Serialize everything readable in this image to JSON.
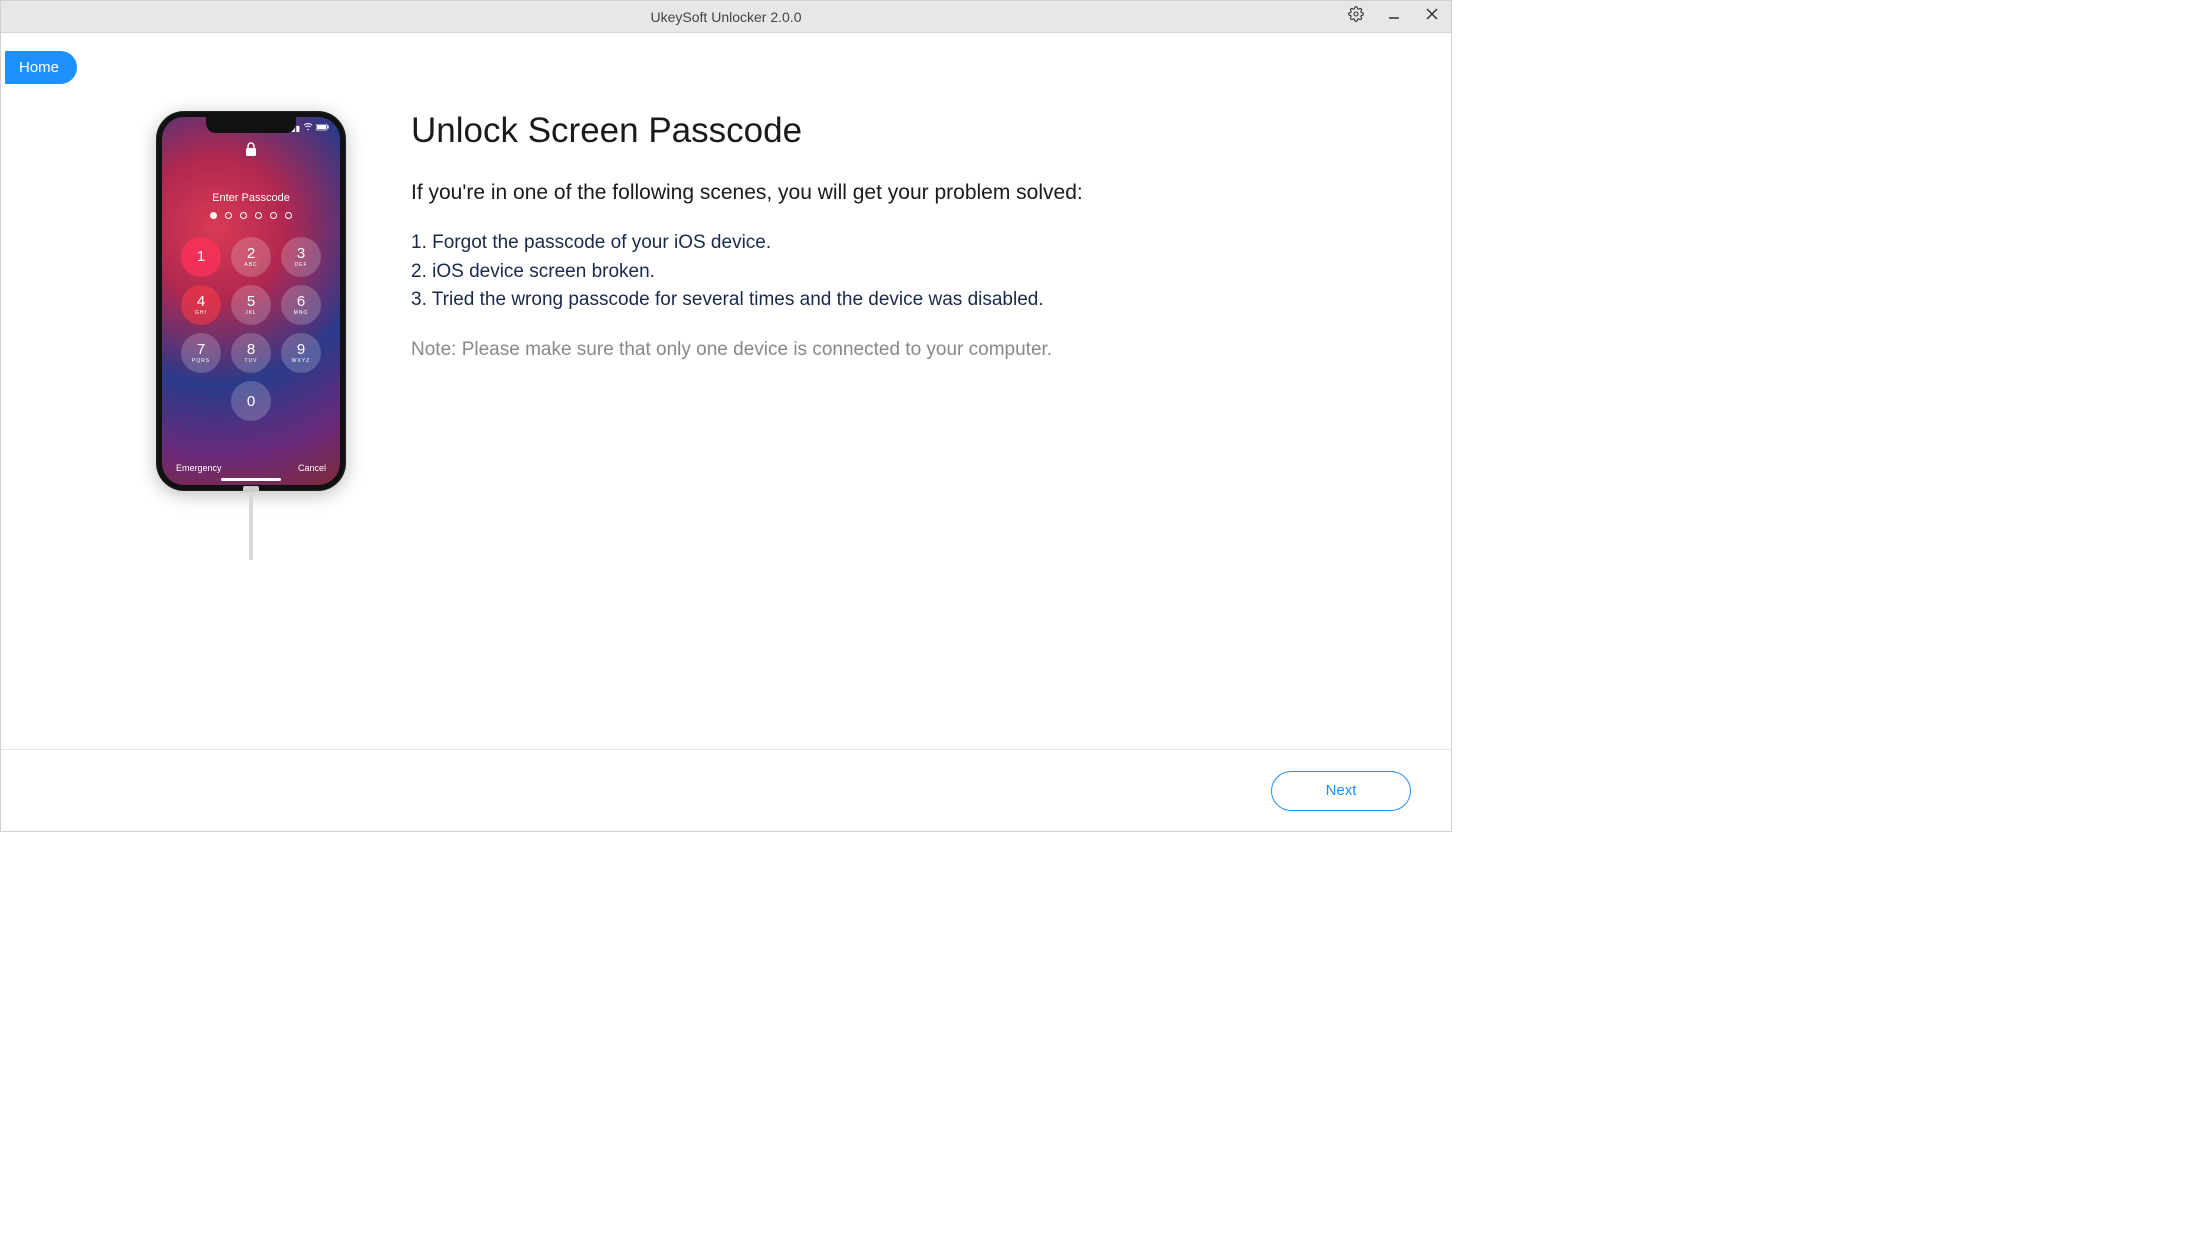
{
  "titlebar": {
    "title": "UkeySoft Unlocker 2.0.0"
  },
  "nav": {
    "home_label": "Home"
  },
  "phone": {
    "enter_passcode": "Enter Passcode",
    "emergency": "Emergency",
    "cancel": "Cancel",
    "keys": [
      {
        "num": "1",
        "letters": ""
      },
      {
        "num": "2",
        "letters": "ABC"
      },
      {
        "num": "3",
        "letters": "DEF"
      },
      {
        "num": "4",
        "letters": "GHI"
      },
      {
        "num": "5",
        "letters": "JKL"
      },
      {
        "num": "6",
        "letters": "MNO"
      },
      {
        "num": "7",
        "letters": "PQRS"
      },
      {
        "num": "8",
        "letters": "TUV"
      },
      {
        "num": "9",
        "letters": "WXYZ"
      },
      {
        "num": "0",
        "letters": ""
      }
    ]
  },
  "main": {
    "heading": "Unlock Screen Passcode",
    "subheading": "If you're in one of the following scenes, you will get your problem solved:",
    "scenes": [
      "1. Forgot the passcode of your iOS device.",
      "2. iOS device screen broken.",
      "3. Tried the wrong passcode for several times and the device was disabled."
    ],
    "note": "Note: Please make sure that only one device is connected to your computer."
  },
  "footer": {
    "next_label": "Next"
  }
}
